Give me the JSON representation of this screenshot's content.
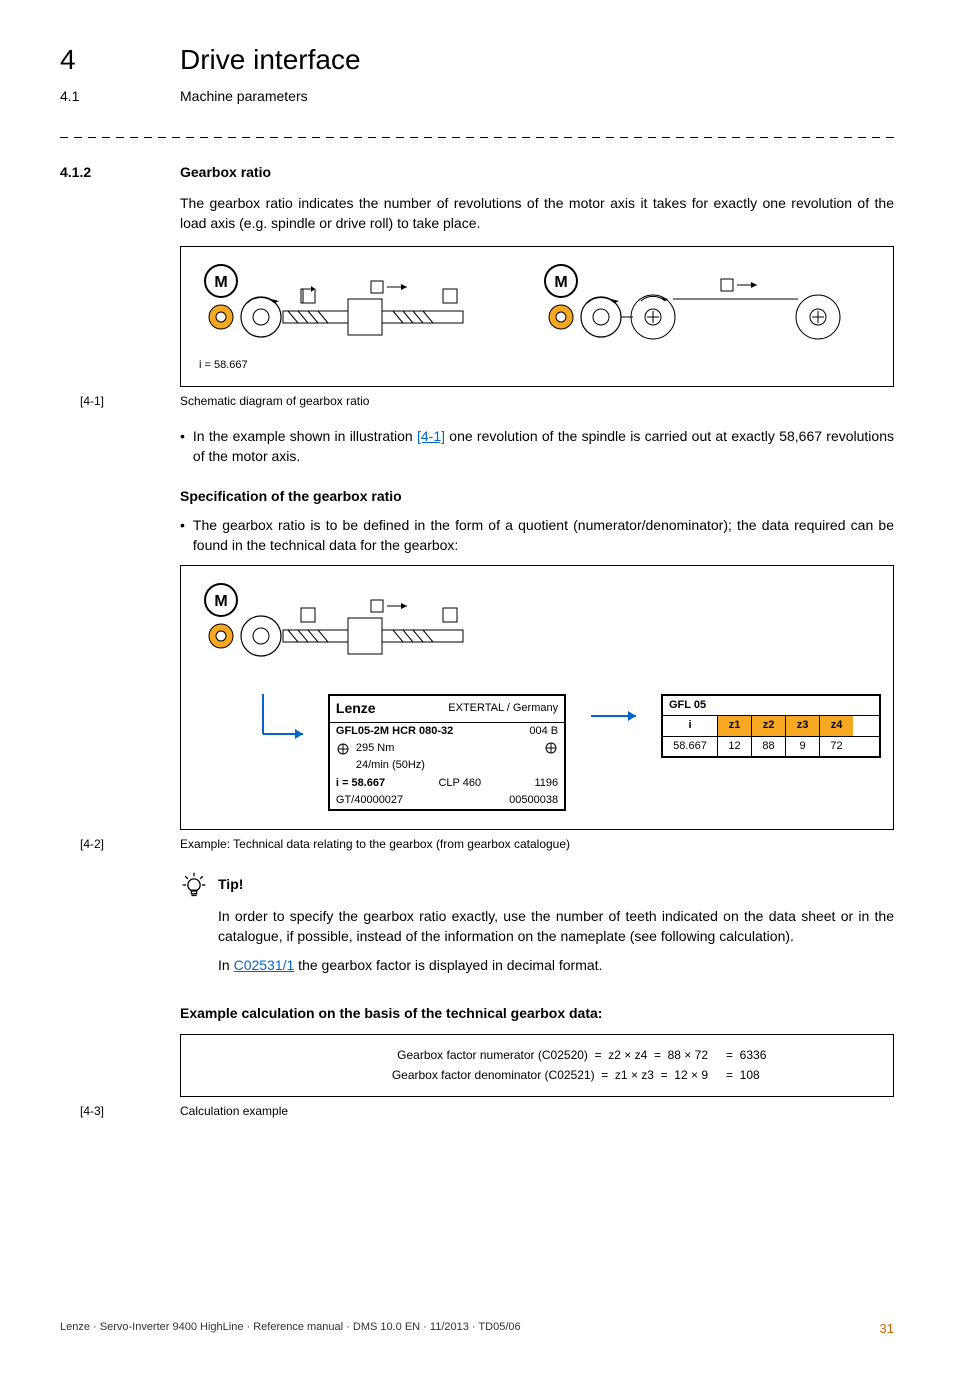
{
  "header": {
    "chapter_num": "4",
    "chapter_title": "Drive interface",
    "section_num": "4.1",
    "section_title": "Machine parameters"
  },
  "section": {
    "num": "4.1.2",
    "title": "Gearbox ratio",
    "intro": "The gearbox ratio indicates the number of revolutions of the motor axis it takes for exactly one revolution of the load axis (e.g. spindle or drive roll) to take place."
  },
  "fig1": {
    "i_label": "i = 58.667",
    "cap_num": "[4-1]",
    "cap_text": "Schematic diagram of gearbox ratio"
  },
  "bullet1_a": "In the example shown in illustration ",
  "bullet1_link": "[4-1]",
  "bullet1_b": " one revolution of the spindle is carried out at exactly 58,667 revolutions of the motor axis.",
  "spec_heading": "Specification of the gearbox ratio",
  "bullet2": "The gearbox ratio is to be defined in the form of a quotient (numerator/denominator); the data required can be found in the technical data for the gearbox:",
  "fig2": {
    "brand_text": "EXTERTAL / Germany",
    "np_line1_l": "GFL05-2M HCR 080-32",
    "np_line1_r": "004 B",
    "np_line2_l": "295 Nm",
    "np_line3_l": "24/min (50Hz)",
    "np_line4_l": "i = 58.667",
    "np_line4_m": "CLP 460",
    "np_line4_r": "1196",
    "np_line5_l": "GT/40000027",
    "np_line5_r": "00500038",
    "gfl_head": "GFL 05",
    "gfl_h_i": "i",
    "gfl_h_z1": "z1",
    "gfl_h_z2": "z2",
    "gfl_h_z3": "z3",
    "gfl_h_z4": "z4",
    "gfl_v_i": "58.667",
    "gfl_v_z1": "12",
    "gfl_v_z2": "88",
    "gfl_v_z3": "9",
    "gfl_v_z4": "72",
    "cap_num": "[4-2]",
    "cap_text": "Example: Technical data relating to the gearbox (from gearbox catalogue)"
  },
  "tip": {
    "title": "Tip!",
    "body1": "In order to specify the gearbox ratio exactly, use the number of teeth indicated on the data sheet or in the catalogue, if possible, instead of the information on the nameplate (see following calculation).",
    "body2_a": "In ",
    "body2_link": "C02531/1",
    "body2_b": " the gearbox factor is displayed in decimal format."
  },
  "calc_heading": "Example calculation on the basis of the technical gearbox data:",
  "calc": {
    "r1_left": "Gearbox factor numerator (C02520)  =  z2 × z4  =  88 × 72",
    "r1_right": "=  6336",
    "r2_left": "Gearbox factor denominator (C02521)  =  z1 × z3  =  12 × 9",
    "r2_right": "=  108",
    "cap_num": "[4-3]",
    "cap_text": "Calculation example"
  },
  "chart_data": {
    "type": "table",
    "title": "GFL 05 gearbox data",
    "columns": [
      "i",
      "z1",
      "z2",
      "z3",
      "z4"
    ],
    "rows": [
      [
        58.667,
        12,
        88,
        9,
        72
      ]
    ],
    "derived": {
      "numerator_formula": "z2 × z4",
      "numerator_value": 6336,
      "denominator_formula": "z1 × z3",
      "denominator_value": 108
    }
  },
  "footer": {
    "left": "Lenze · Servo-Inverter 9400 HighLine · Reference manual · DMS 10.0 EN · 11/2013 · TD05/06",
    "page": "31"
  }
}
